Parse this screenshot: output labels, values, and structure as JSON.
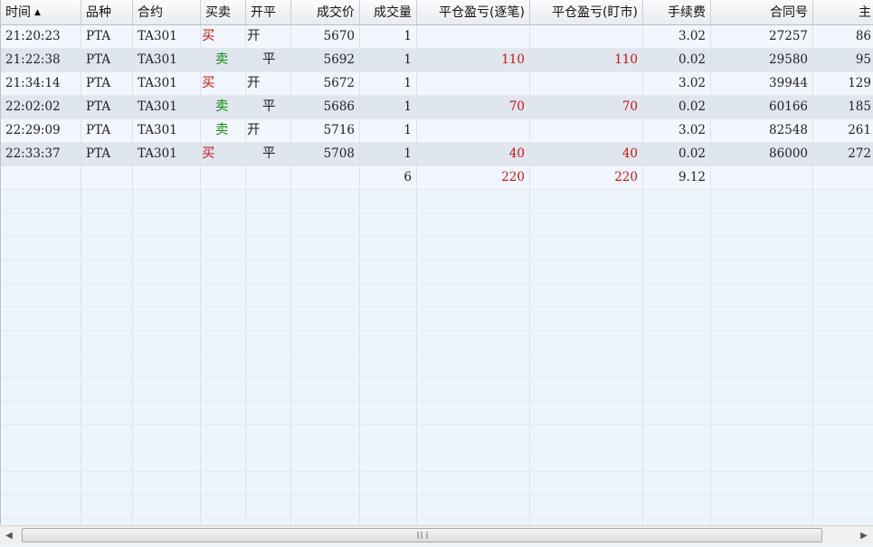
{
  "table": {
    "headers": [
      "时间",
      "品种",
      "合约",
      "买卖",
      "开平",
      "成交价",
      "成交量",
      "平仓盈亏(逐笔)",
      "平仓盈亏(盯市)",
      "手续费",
      "合同号",
      "主"
    ],
    "sort_indicator": "▲",
    "rows": [
      {
        "time": "21:20:23",
        "product": "PTA",
        "contract": "TA301",
        "side": "买",
        "open_close": "开",
        "price": "5670",
        "volume": "1",
        "pnl_trade": "",
        "pnl_mtm": "",
        "fee": "3.02",
        "contract_no": "27257",
        "extra": "86"
      },
      {
        "time": "21:22:38",
        "product": "PTA",
        "contract": "TA301",
        "side": "卖",
        "open_close": "平",
        "price": "5692",
        "volume": "1",
        "pnl_trade": "110",
        "pnl_mtm": "110",
        "fee": "0.02",
        "contract_no": "29580",
        "extra": "95"
      },
      {
        "time": "21:34:14",
        "product": "PTA",
        "contract": "TA301",
        "side": "买",
        "open_close": "开",
        "price": "5672",
        "volume": "1",
        "pnl_trade": "",
        "pnl_mtm": "",
        "fee": "3.02",
        "contract_no": "39944",
        "extra": "129"
      },
      {
        "time": "22:02:02",
        "product": "PTA",
        "contract": "TA301",
        "side": "卖",
        "open_close": "平",
        "price": "5686",
        "volume": "1",
        "pnl_trade": "70",
        "pnl_mtm": "70",
        "fee": "0.02",
        "contract_no": "60166",
        "extra": "185"
      },
      {
        "time": "22:29:09",
        "product": "PTA",
        "contract": "TA301",
        "side": "卖",
        "open_close": "开",
        "price": "5716",
        "volume": "1",
        "pnl_trade": "",
        "pnl_mtm": "",
        "fee": "3.02",
        "contract_no": "82548",
        "extra": "261"
      },
      {
        "time": "22:33:37",
        "product": "PTA",
        "contract": "TA301",
        "side": "买",
        "open_close": "平",
        "price": "5708",
        "volume": "1",
        "pnl_trade": "40",
        "pnl_mtm": "40",
        "fee": "0.02",
        "contract_no": "86000",
        "extra": "272"
      }
    ],
    "summary": {
      "volume": "6",
      "pnl_trade": "220",
      "pnl_mtm": "220",
      "fee": "9.12"
    }
  },
  "colors": {
    "buy": "#cc1010",
    "sell": "#1a8a1a",
    "profit": "#cc1010"
  },
  "scrollbar": {
    "left_icon": "◀",
    "right_icon": "▶",
    "grip_icon": "grip-icon"
  }
}
